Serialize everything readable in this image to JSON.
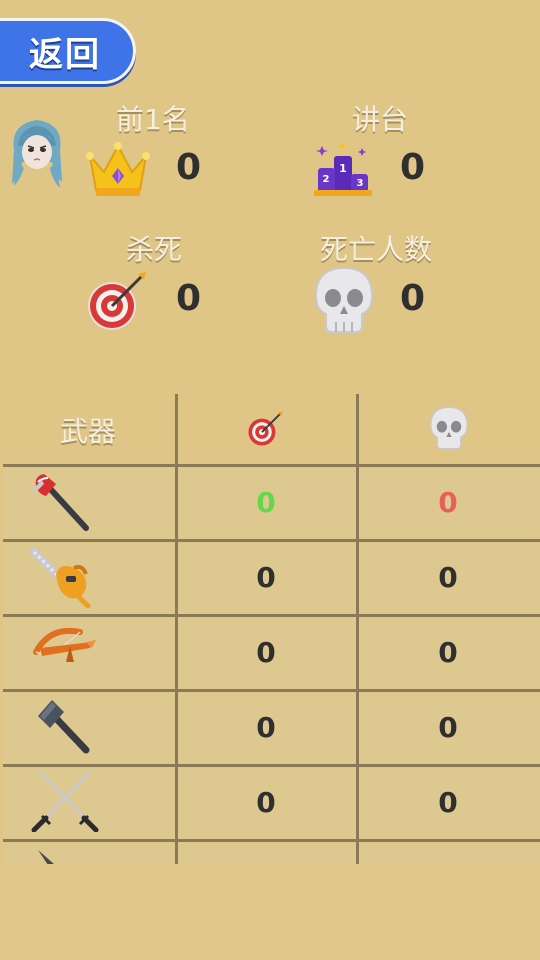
{
  "header": {
    "back_label": "返回"
  },
  "stats": {
    "top1": {
      "label": "前1名",
      "value": "0",
      "icon": "crown-icon"
    },
    "podium": {
      "label": "讲台",
      "value": "0",
      "icon": "podium-icon"
    },
    "kills": {
      "label": "杀死",
      "value": "0",
      "icon": "target-icon"
    },
    "deaths": {
      "label": "死亡人数",
      "value": "0",
      "icon": "skull-icon"
    }
  },
  "table": {
    "header": {
      "weapon": "武器",
      "kills_icon": "target-icon",
      "deaths_icon": "skull-icon"
    },
    "rows": [
      {
        "weapon_icon": "axe-icon",
        "kills": "0",
        "deaths": "0"
      },
      {
        "weapon_icon": "chainsaw-icon",
        "kills": "0",
        "deaths": "0"
      },
      {
        "weapon_icon": "crossbow-icon",
        "kills": "0",
        "deaths": "0"
      },
      {
        "weapon_icon": "hammer-icon",
        "kills": "0",
        "deaths": "0"
      },
      {
        "weapon_icon": "crossed-swords-icon",
        "kills": "0",
        "deaths": "0"
      },
      {
        "weapon_icon": "knife-icon",
        "kills": "",
        "deaths": ""
      }
    ]
  },
  "colors": {
    "background": "#dfc687",
    "back_button": "#3f74e8",
    "first_row_kills": "#62d84a",
    "first_row_deaths": "#e8605a",
    "value_text": "#2f2f2f",
    "grid_line": "#8b7a58"
  }
}
